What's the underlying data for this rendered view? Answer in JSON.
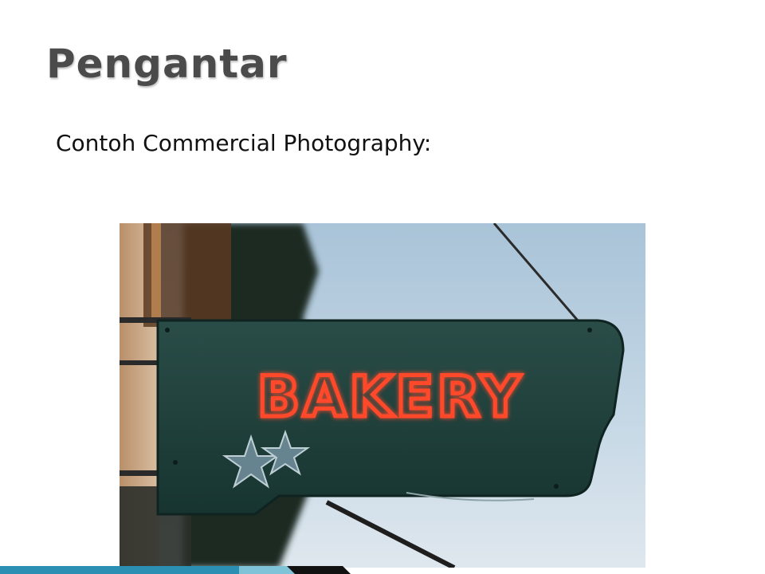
{
  "slide": {
    "title": "Pengantar",
    "body_text": "Contoh Commercial Photography:"
  },
  "photo": {
    "subject": "neon-bakery-sign-photo",
    "sign_text": "BAKERY",
    "colors": {
      "sky": "#b9cfe0",
      "sign_panel": "#1f403b",
      "neon": "#e8432c",
      "wall": "#c9a98a"
    }
  },
  "footer": {
    "accent_colors": [
      "#2b8fb3",
      "#7fc3d9",
      "#111111"
    ]
  }
}
